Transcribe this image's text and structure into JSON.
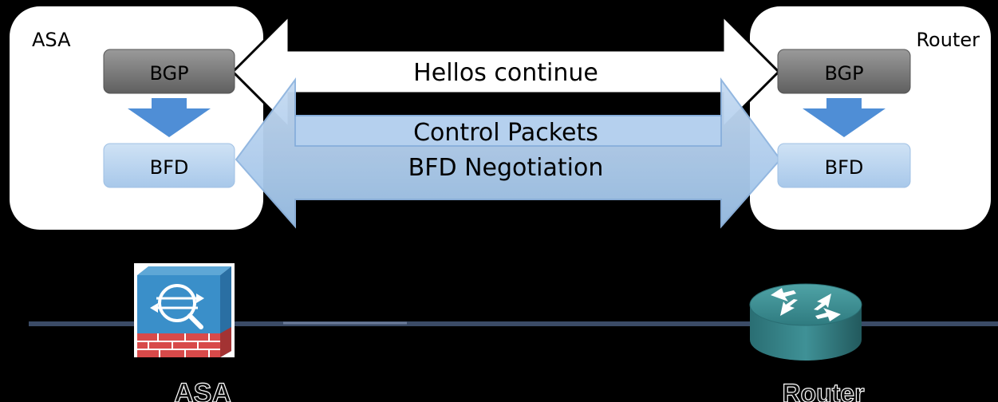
{
  "asa_panel": {
    "label": "ASA",
    "bgp_label": "BGP",
    "bfd_label": "BFD"
  },
  "router_panel": {
    "label": "Router",
    "bgp_label": "BGP",
    "bfd_label": "BFD"
  },
  "arrows": {
    "hello_label": "Hellos continue",
    "control_label": "Control Packets",
    "negotiation_label": "BFD Negotiation"
  },
  "devices": {
    "asa_label": "ASA",
    "router_label": "Router",
    "asa_icon": "firewall-icon",
    "router_icon": "router-icon"
  },
  "colors": {
    "panel": "#ffffff",
    "bgp_box": "#6f6f6f",
    "bfd_box": "#b9d5ef",
    "bfd_arrow": "#a9c8ea",
    "down_arrow": "#4f8ed6",
    "network_line": "#3b4b66"
  }
}
